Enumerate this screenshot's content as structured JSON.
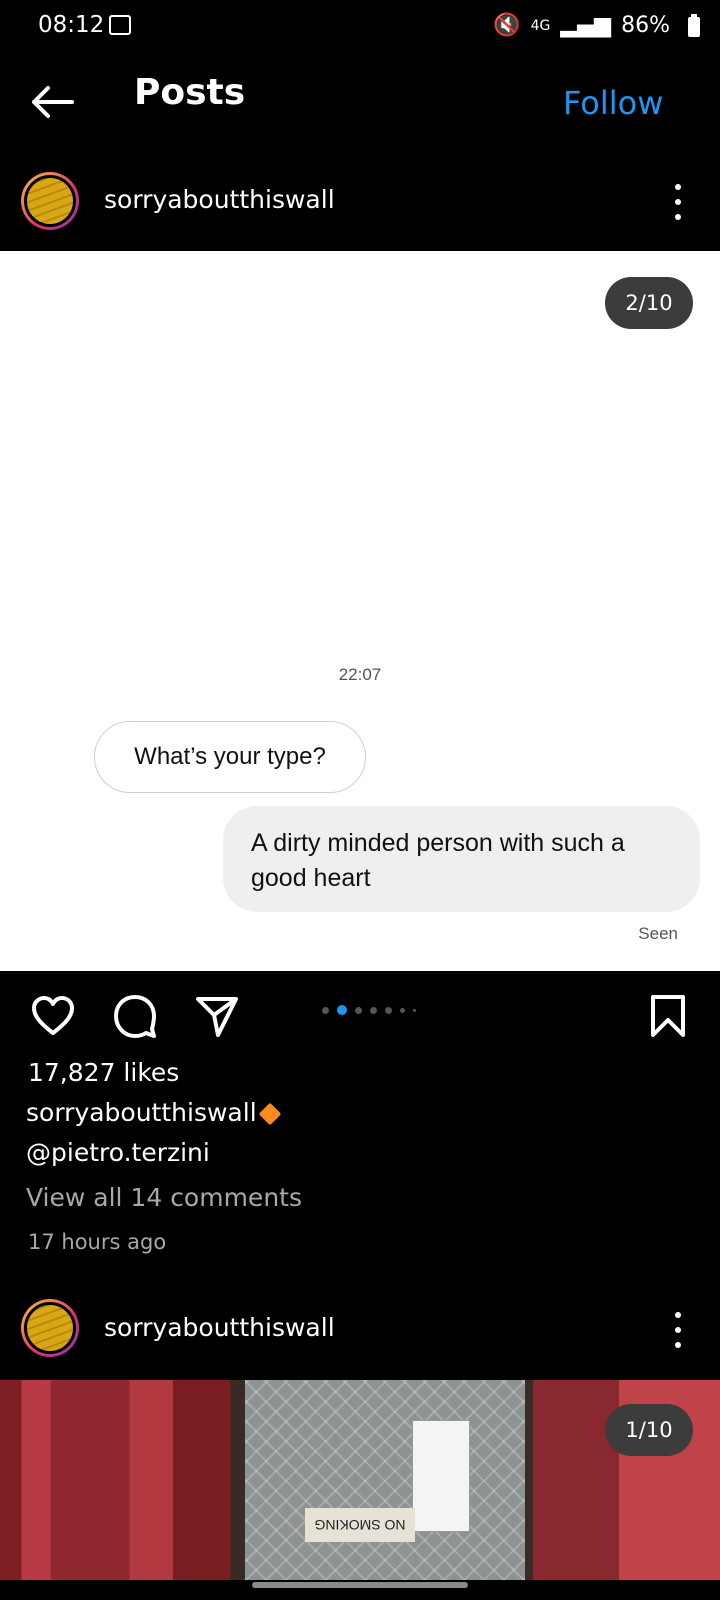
{
  "status_bar": {
    "time": "08:12",
    "signal_text": "4G",
    "battery": "86%"
  },
  "header": {
    "title": "Posts",
    "follow_label": "Follow"
  },
  "post1": {
    "username": "sorryaboutthiswall",
    "counter": "2/10",
    "chat": {
      "time": "22:07",
      "incoming": "What’s your type?",
      "outgoing": "A dirty minded person with such a good heart",
      "status": "Seen"
    },
    "likes": "17,827 likes",
    "caption_user": "sorryaboutthiswall",
    "caption_text": "@pietro.terzini",
    "view_comments": "View all 14 comments",
    "time_ago": "17 hours ago",
    "carousel": {
      "count": 7,
      "active_index": 1
    }
  },
  "post2": {
    "username": "sorryaboutthiswall",
    "counter": "1/10",
    "sign_text": "NO SMOKING"
  },
  "colors": {
    "accent": "#1e95f0",
    "background": "#000000",
    "caption_badge": "#ff8a1f"
  }
}
